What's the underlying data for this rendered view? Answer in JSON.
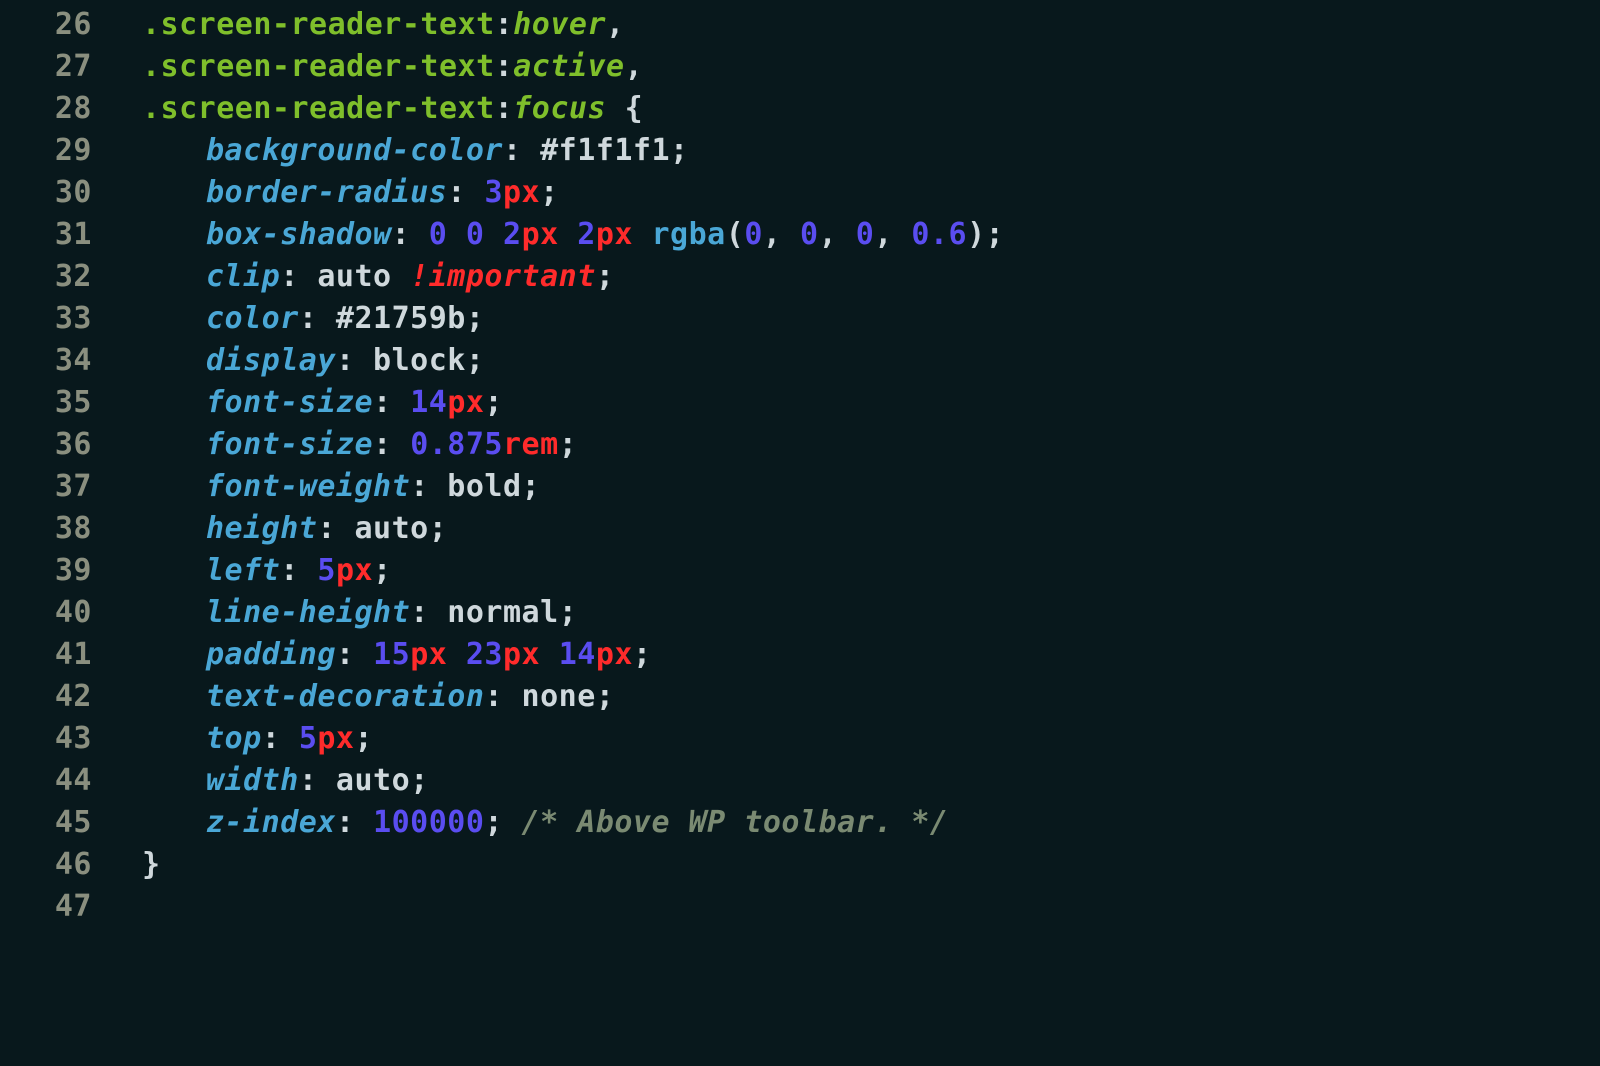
{
  "lines": [
    {
      "num": "26",
      "indent": 1,
      "tokens": [
        {
          "t": ".screen-reader-text",
          "c": "sel"
        },
        {
          "t": ":",
          "c": "colon"
        },
        {
          "t": "hover",
          "c": "pseudo"
        },
        {
          "t": ",",
          "c": "colon"
        }
      ]
    },
    {
      "num": "27",
      "indent": 1,
      "tokens": [
        {
          "t": ".screen-reader-text",
          "c": "sel"
        },
        {
          "t": ":",
          "c": "colon"
        },
        {
          "t": "active",
          "c": "pseudo"
        },
        {
          "t": ",",
          "c": "colon"
        }
      ]
    },
    {
      "num": "28",
      "indent": 1,
      "tokens": [
        {
          "t": ".screen-reader-text",
          "c": "sel"
        },
        {
          "t": ":",
          "c": "colon"
        },
        {
          "t": "focus",
          "c": "pseudo"
        },
        {
          "t": " {",
          "c": "brace"
        }
      ]
    },
    {
      "num": "29",
      "indent": 2,
      "tokens": [
        {
          "t": "background-color",
          "c": "prop"
        },
        {
          "t": ":",
          "c": "colon"
        },
        {
          "t": " #f1f1f1",
          "c": "hex"
        },
        {
          "t": ";",
          "c": "semi"
        }
      ]
    },
    {
      "num": "30",
      "indent": 2,
      "tokens": [
        {
          "t": "border-radius",
          "c": "prop"
        },
        {
          "t": ":",
          "c": "colon"
        },
        {
          "t": " ",
          "c": "colon"
        },
        {
          "t": "3",
          "c": "num"
        },
        {
          "t": "px",
          "c": "unit"
        },
        {
          "t": ";",
          "c": "semi"
        }
      ]
    },
    {
      "num": "31",
      "indent": 2,
      "tokens": [
        {
          "t": "box-shadow",
          "c": "prop"
        },
        {
          "t": ":",
          "c": "colon"
        },
        {
          "t": " ",
          "c": "colon"
        },
        {
          "t": "0",
          "c": "num"
        },
        {
          "t": " ",
          "c": "colon"
        },
        {
          "t": "0",
          "c": "num"
        },
        {
          "t": " ",
          "c": "colon"
        },
        {
          "t": "2",
          "c": "num"
        },
        {
          "t": "px",
          "c": "unit"
        },
        {
          "t": " ",
          "c": "colon"
        },
        {
          "t": "2",
          "c": "num"
        },
        {
          "t": "px",
          "c": "unit"
        },
        {
          "t": " ",
          "c": "colon"
        },
        {
          "t": "rgba",
          "c": "fn"
        },
        {
          "t": "(",
          "c": "colon"
        },
        {
          "t": "0",
          "c": "num"
        },
        {
          "t": ", ",
          "c": "colon"
        },
        {
          "t": "0",
          "c": "num"
        },
        {
          "t": ", ",
          "c": "colon"
        },
        {
          "t": "0",
          "c": "num"
        },
        {
          "t": ", ",
          "c": "colon"
        },
        {
          "t": "0.6",
          "c": "num"
        },
        {
          "t": ")",
          "c": "colon"
        },
        {
          "t": ";",
          "c": "semi"
        }
      ]
    },
    {
      "num": "32",
      "indent": 2,
      "tokens": [
        {
          "t": "clip",
          "c": "prop"
        },
        {
          "t": ":",
          "c": "colon"
        },
        {
          "t": " auto ",
          "c": "valw"
        },
        {
          "t": "!important",
          "c": "kw"
        },
        {
          "t": ";",
          "c": "semi"
        }
      ]
    },
    {
      "num": "33",
      "indent": 2,
      "tokens": [
        {
          "t": "color",
          "c": "prop"
        },
        {
          "t": ":",
          "c": "colon"
        },
        {
          "t": " #21759b",
          "c": "hex"
        },
        {
          "t": ";",
          "c": "semi"
        }
      ]
    },
    {
      "num": "34",
      "indent": 2,
      "tokens": [
        {
          "t": "display",
          "c": "prop"
        },
        {
          "t": ":",
          "c": "colon"
        },
        {
          "t": " block",
          "c": "valw"
        },
        {
          "t": ";",
          "c": "semi"
        }
      ]
    },
    {
      "num": "35",
      "indent": 2,
      "tokens": [
        {
          "t": "font-size",
          "c": "prop"
        },
        {
          "t": ":",
          "c": "colon"
        },
        {
          "t": " ",
          "c": "colon"
        },
        {
          "t": "14",
          "c": "num"
        },
        {
          "t": "px",
          "c": "unit"
        },
        {
          "t": ";",
          "c": "semi"
        }
      ]
    },
    {
      "num": "36",
      "indent": 2,
      "tokens": [
        {
          "t": "font-size",
          "c": "prop"
        },
        {
          "t": ":",
          "c": "colon"
        },
        {
          "t": " ",
          "c": "colon"
        },
        {
          "t": "0.875",
          "c": "num"
        },
        {
          "t": "rem",
          "c": "unit"
        },
        {
          "t": ";",
          "c": "semi"
        }
      ]
    },
    {
      "num": "37",
      "indent": 2,
      "tokens": [
        {
          "t": "font-weight",
          "c": "prop"
        },
        {
          "t": ":",
          "c": "colon"
        },
        {
          "t": " bold",
          "c": "valw"
        },
        {
          "t": ";",
          "c": "semi"
        }
      ]
    },
    {
      "num": "38",
      "indent": 2,
      "tokens": [
        {
          "t": "height",
          "c": "prop"
        },
        {
          "t": ":",
          "c": "colon"
        },
        {
          "t": " auto",
          "c": "valw"
        },
        {
          "t": ";",
          "c": "semi"
        }
      ]
    },
    {
      "num": "39",
      "indent": 2,
      "tokens": [
        {
          "t": "left",
          "c": "prop"
        },
        {
          "t": ":",
          "c": "colon"
        },
        {
          "t": " ",
          "c": "colon"
        },
        {
          "t": "5",
          "c": "num"
        },
        {
          "t": "px",
          "c": "unit"
        },
        {
          "t": ";",
          "c": "semi"
        }
      ]
    },
    {
      "num": "40",
      "indent": 2,
      "tokens": [
        {
          "t": "line-height",
          "c": "prop"
        },
        {
          "t": ":",
          "c": "colon"
        },
        {
          "t": " normal",
          "c": "valw"
        },
        {
          "t": ";",
          "c": "semi"
        }
      ]
    },
    {
      "num": "41",
      "indent": 2,
      "tokens": [
        {
          "t": "padding",
          "c": "prop"
        },
        {
          "t": ":",
          "c": "colon"
        },
        {
          "t": " ",
          "c": "colon"
        },
        {
          "t": "15",
          "c": "num"
        },
        {
          "t": "px",
          "c": "unit"
        },
        {
          "t": " ",
          "c": "colon"
        },
        {
          "t": "23",
          "c": "num"
        },
        {
          "t": "px",
          "c": "unit"
        },
        {
          "t": " ",
          "c": "colon"
        },
        {
          "t": "14",
          "c": "num"
        },
        {
          "t": "px",
          "c": "unit"
        },
        {
          "t": ";",
          "c": "semi"
        }
      ]
    },
    {
      "num": "42",
      "indent": 2,
      "tokens": [
        {
          "t": "text-decoration",
          "c": "prop"
        },
        {
          "t": ":",
          "c": "colon"
        },
        {
          "t": " none",
          "c": "valw"
        },
        {
          "t": ";",
          "c": "semi"
        }
      ]
    },
    {
      "num": "43",
      "indent": 2,
      "tokens": [
        {
          "t": "top",
          "c": "prop"
        },
        {
          "t": ":",
          "c": "colon"
        },
        {
          "t": " ",
          "c": "colon"
        },
        {
          "t": "5",
          "c": "num"
        },
        {
          "t": "px",
          "c": "unit"
        },
        {
          "t": ";",
          "c": "semi"
        }
      ]
    },
    {
      "num": "44",
      "indent": 2,
      "tokens": [
        {
          "t": "width",
          "c": "prop"
        },
        {
          "t": ":",
          "c": "colon"
        },
        {
          "t": " auto",
          "c": "valw"
        },
        {
          "t": ";",
          "c": "semi"
        }
      ]
    },
    {
      "num": "45",
      "indent": 2,
      "tokens": [
        {
          "t": "z-index",
          "c": "prop"
        },
        {
          "t": ":",
          "c": "colon"
        },
        {
          "t": " ",
          "c": "colon"
        },
        {
          "t": "100000",
          "c": "num"
        },
        {
          "t": ";",
          "c": "semi"
        },
        {
          "t": " /* Above WP toolbar. */",
          "c": "cm"
        }
      ]
    },
    {
      "num": "46",
      "indent": 1,
      "tokens": [
        {
          "t": "}",
          "c": "brace"
        }
      ]
    },
    {
      "num": "47",
      "indent": 1,
      "tokens": []
    }
  ]
}
